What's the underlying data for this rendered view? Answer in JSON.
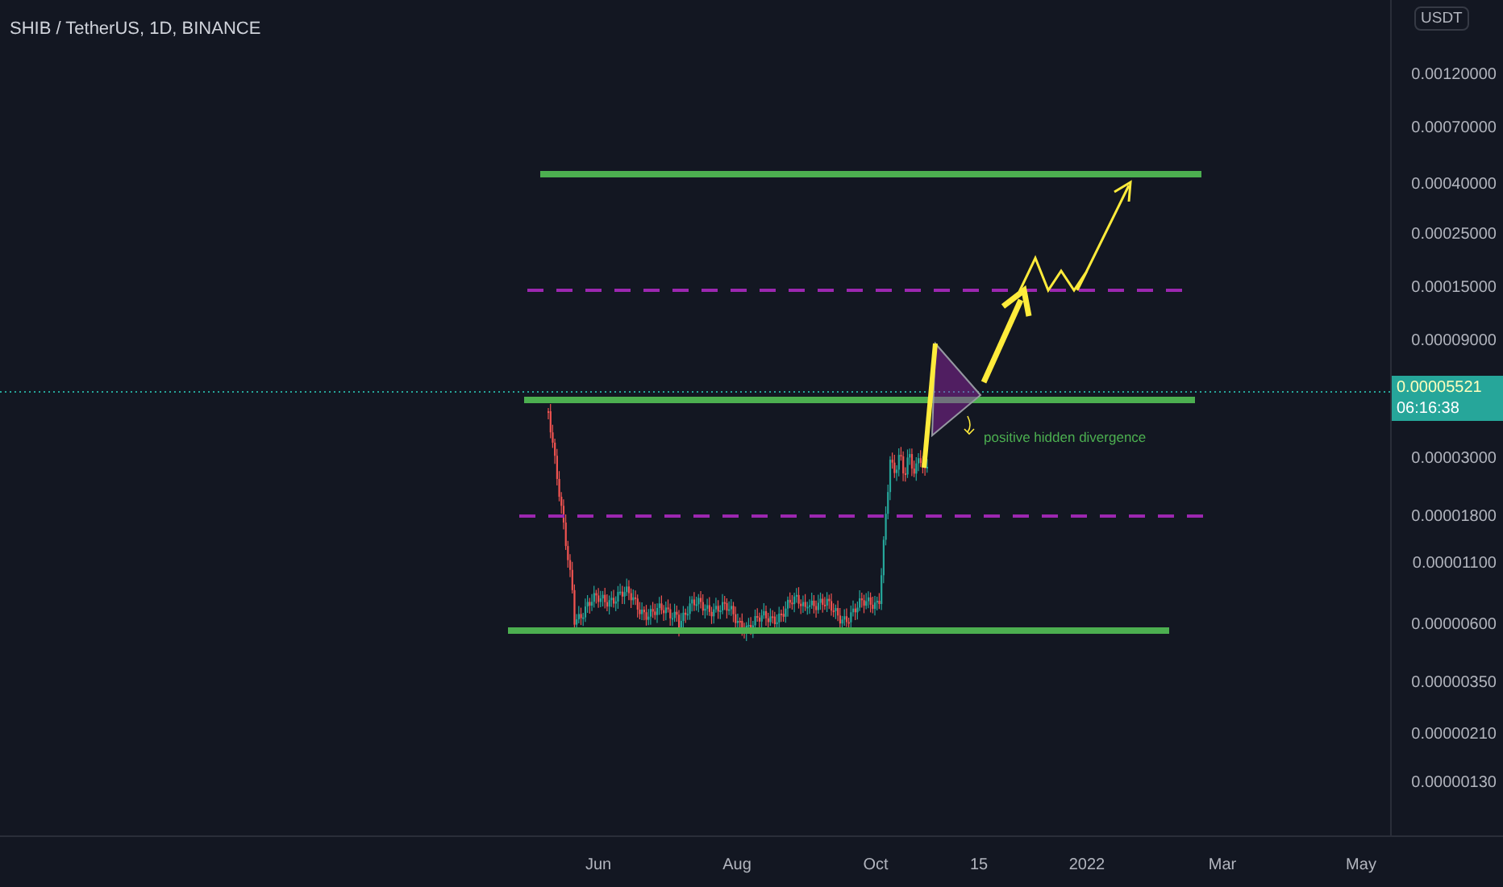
{
  "header": {
    "title": "SHIB / TetherUS, 1D, BINANCE"
  },
  "price_axis": {
    "currency": "USDT",
    "labels": [
      "0.00120000",
      "0.00070000",
      "0.00040000",
      "0.00025000",
      "0.00015000",
      "0.00009000",
      "0.00003000",
      "0.00001800",
      "0.00001100",
      "0.00000600",
      "0.00000350",
      "0.00000210",
      "0.00000130"
    ],
    "last_price": "0.00005521",
    "countdown": "06:16:38"
  },
  "time_axis": {
    "labels": [
      "Jun",
      "Aug",
      "Oct",
      "15",
      "2022",
      "Mar",
      "May"
    ]
  },
  "annotation": {
    "text": "positive hidden divergence"
  }
}
